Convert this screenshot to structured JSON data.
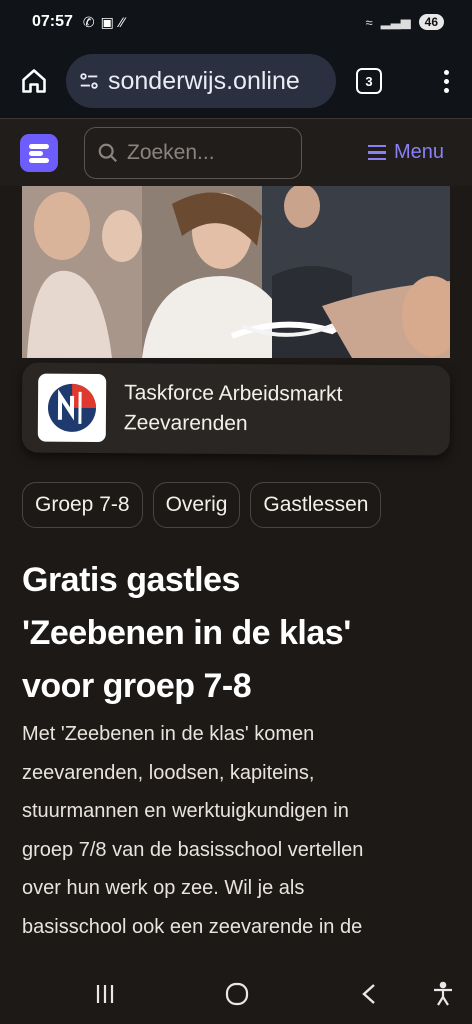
{
  "status_bar": {
    "time": "07:57",
    "battery": "46"
  },
  "browser": {
    "url": "⁠sonderwijs.online",
    "tab_count": "3"
  },
  "site_header": {
    "search_placeholder": "Zoeken...",
    "menu_label": "Menu"
  },
  "org": {
    "name_line1": "Taskforce Arbeidsmarkt",
    "name_line2": "Zeevarenden"
  },
  "tags": [
    "Groep 7-8",
    "Overig",
    "Gastlessen"
  ],
  "article": {
    "title_line1": "Gratis gastles",
    "title_line2": "'Zeebenen in de klas'",
    "title_line3": "voor groep 7-8",
    "body_lines": [
      "Met 'Zeebenen in de klas' komen",
      "zeevarenden, loodsen, kapiteins,",
      "stuurmannen en werktuigkundigen in",
      "groep 7/8 van de basisschool vertellen",
      "over hun werk op zee. Wil je als",
      "basisschool ook een zeevarende in de"
    ]
  },
  "colors": {
    "accent": "#8b7ff7",
    "logo_bg": "#6d5dfc",
    "page_bg": "#1c1917"
  }
}
